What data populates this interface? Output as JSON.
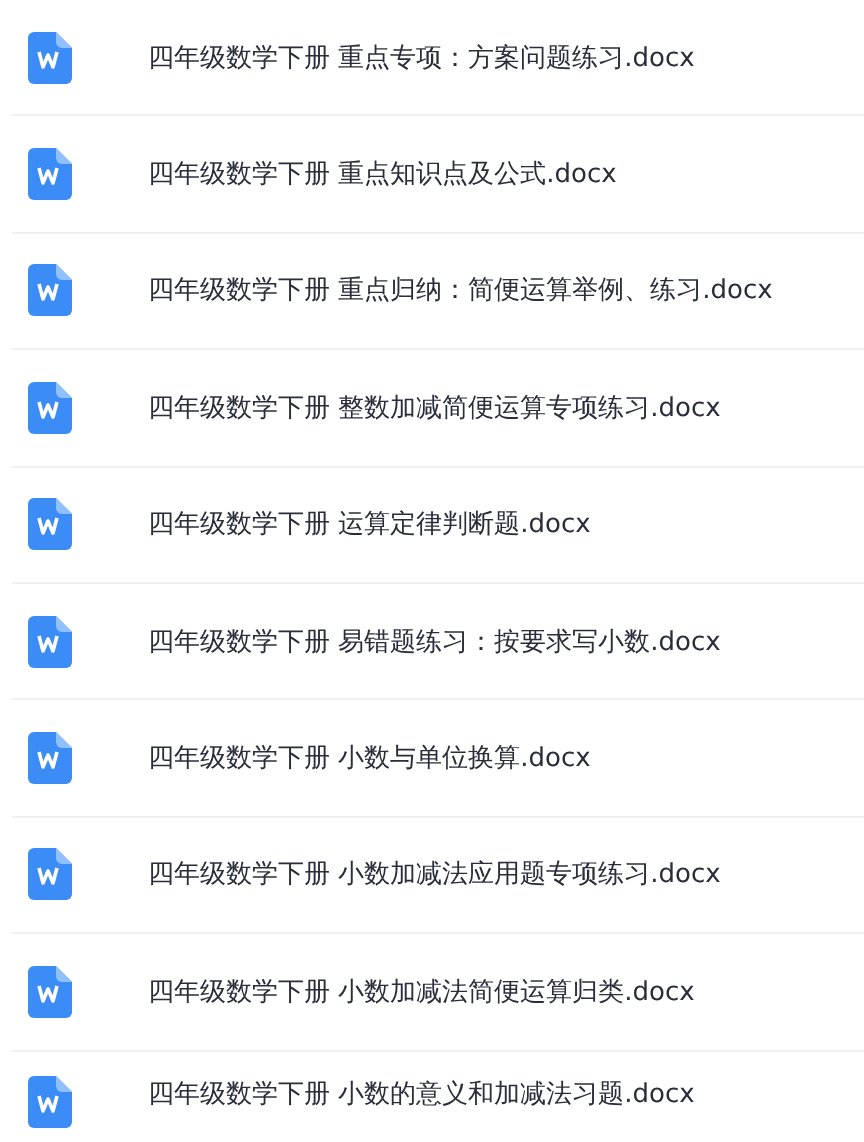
{
  "files": [
    {
      "name": "四年级数学下册 重点专项：方案问题练习.docx"
    },
    {
      "name": "四年级数学下册 重点知识点及公式.docx"
    },
    {
      "name": "四年级数学下册 重点归纳：简便运算举例、练习.docx"
    },
    {
      "name": "四年级数学下册 整数加减简便运算专项练习.docx"
    },
    {
      "name": "四年级数学下册 运算定律判断题.docx"
    },
    {
      "name": "四年级数学下册 易错题练习：按要求写小数.docx"
    },
    {
      "name": "四年级数学下册 小数与单位换算.docx"
    },
    {
      "name": "四年级数学下册 小数加减法应用题专项练习.docx"
    },
    {
      "name": "四年级数学下册 小数加减法简便运算归类.docx"
    },
    {
      "name": "四年级数学下册 小数的意义和加减法习题.docx"
    }
  ]
}
